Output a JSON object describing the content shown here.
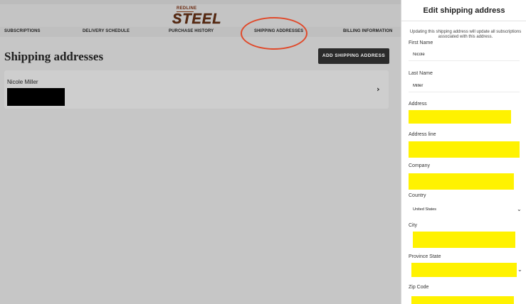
{
  "brand": {
    "small": "REDLINE",
    "main": "STEEL"
  },
  "nav": {
    "subscriptions": "SUBSCRIPTIONS",
    "delivery": "DELIVERY SCHEDULE",
    "purchase": "PURCHASE HISTORY",
    "shipping": "SHIPPING ADDRESSES",
    "billing": "BILLING INFORMATION"
  },
  "main": {
    "title": "Shipping addresses",
    "add_button": "ADD SHIPPING ADDRESS",
    "card": {
      "name": "Nicole Miller",
      "chevron": "›"
    }
  },
  "drawer": {
    "title": "Edit shipping address",
    "note": "Updating this shipping address will update all subscriptions associated with this address.",
    "first_name_label": "First Name",
    "first_name_value": "Nicole",
    "last_name_label": "Last Name",
    "last_name_value": "Miller",
    "address_label": "Address",
    "address_line_label": "Address line",
    "company_label": "Company",
    "country_label": "Country",
    "country_value": "United States",
    "city_label": "City",
    "province_label": "Province State",
    "zip_label": "Zip Code"
  },
  "colors": {
    "highlight": "#fff200",
    "annotation": "#e0492a",
    "button": "#2b2b2b"
  }
}
